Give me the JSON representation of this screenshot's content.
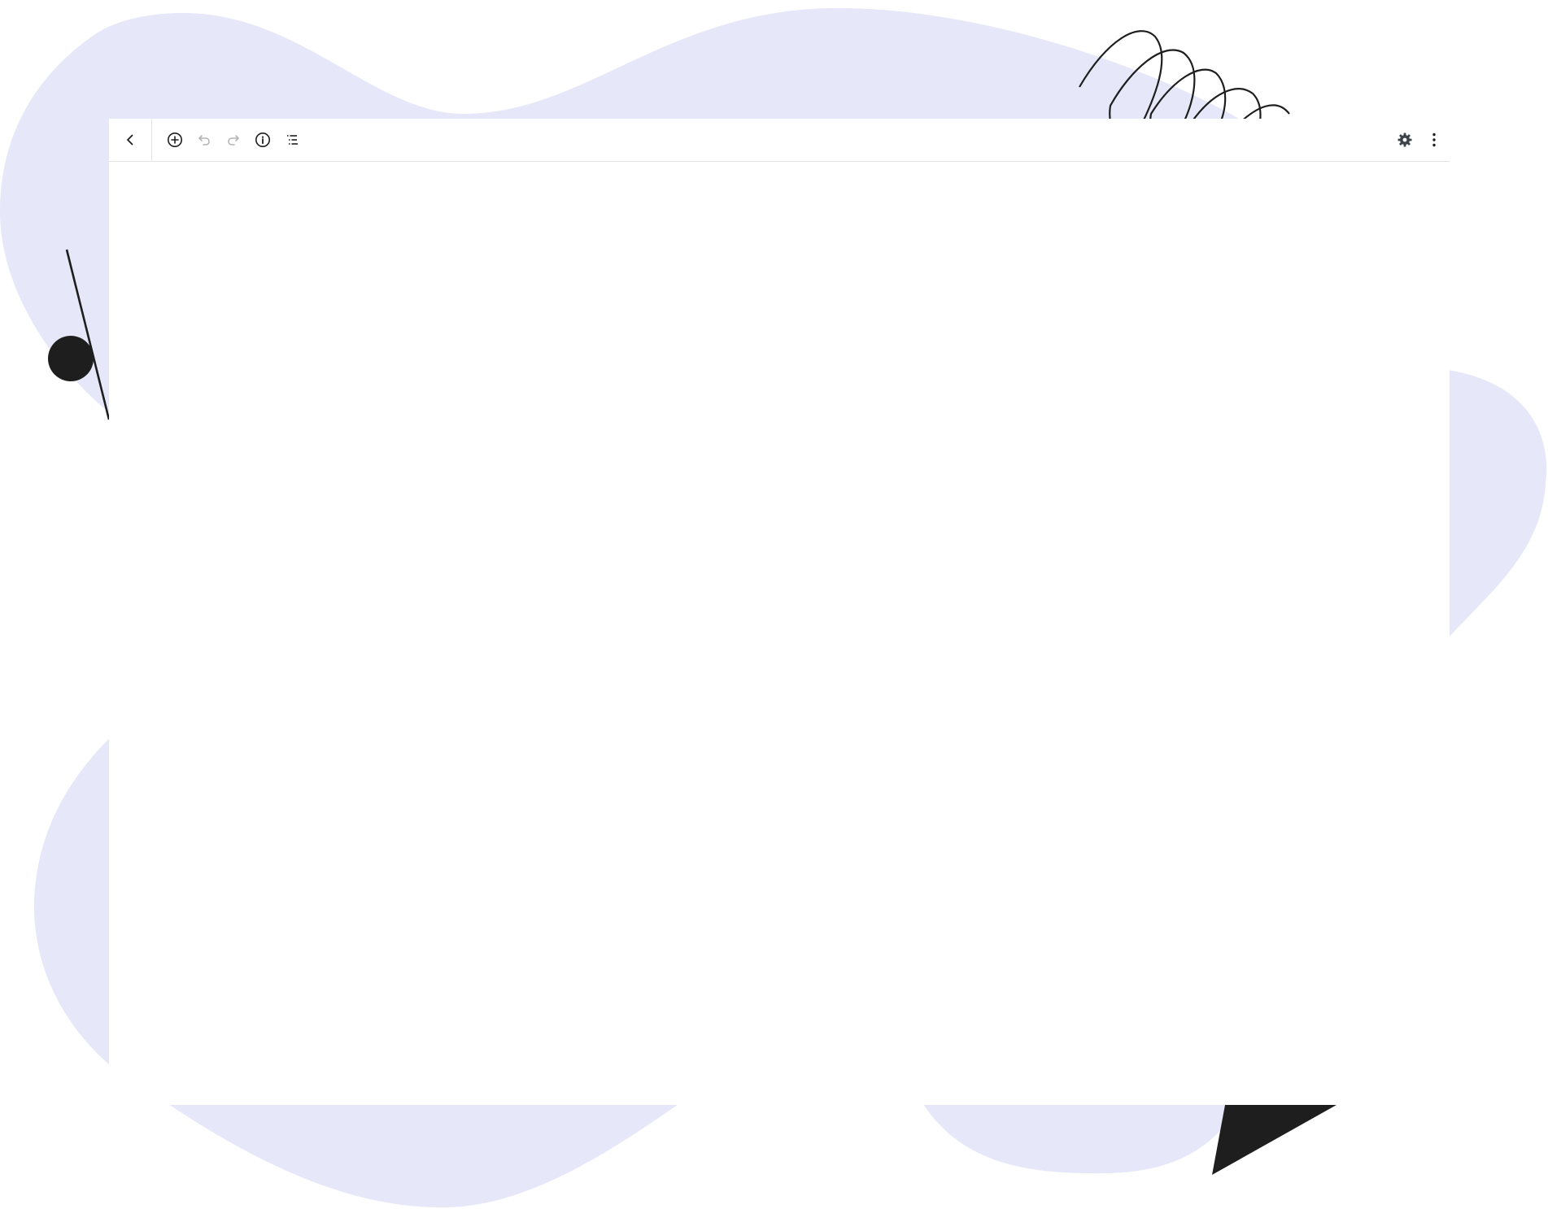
{
  "colors": {
    "blob": "#e6e7f8",
    "ink": "#1e1e1e",
    "icon": "#1e1e1e",
    "icon_disabled": "#b4b4b4",
    "settings_icon": "#3c434a",
    "divider": "#e4e4e4"
  },
  "toolbar": {
    "left_icons": [
      "chevron-left",
      "plus-circle",
      "undo",
      "redo",
      "info-circle",
      "list-view"
    ],
    "undo_enabled": false,
    "redo_enabled": false,
    "right_icons": [
      "gear",
      "more-vertical"
    ]
  }
}
